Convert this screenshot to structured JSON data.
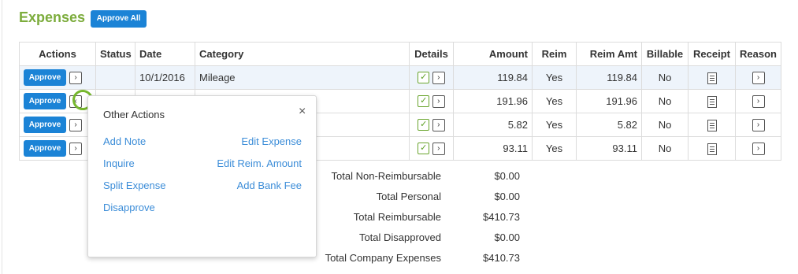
{
  "header": {
    "title": "Expenses",
    "approve_all_label": "Approve All"
  },
  "table": {
    "columns": [
      "Actions",
      "Status",
      "Date",
      "Category",
      "Details",
      "Amount",
      "Reim",
      "Reim Amt",
      "Billable",
      "Receipt",
      "Reason"
    ],
    "approve_label": "Approve",
    "rows": [
      {
        "status": "",
        "date": "10/1/2016",
        "category": "Mileage",
        "amount": "119.84",
        "reim": "Yes",
        "reim_amt": "119.84",
        "billable": "No"
      },
      {
        "status": "",
        "date": "",
        "category": "",
        "amount": "191.96",
        "reim": "Yes",
        "reim_amt": "191.96",
        "billable": "No"
      },
      {
        "status": "",
        "date": "",
        "category": "",
        "amount": "5.82",
        "reim": "Yes",
        "reim_amt": "5.82",
        "billable": "No"
      },
      {
        "status": "",
        "date": "",
        "category": "",
        "amount": "93.11",
        "reim": "Yes",
        "reim_amt": "93.11",
        "billable": "No"
      }
    ]
  },
  "popup": {
    "title": "Other Actions",
    "close": "×",
    "left_actions": [
      "Add Note",
      "Inquire",
      "Split Expense",
      "Disapprove"
    ],
    "right_actions": [
      "Edit Expense",
      "Edit Reim. Amount",
      "Add Bank Fee"
    ]
  },
  "totals": [
    {
      "label": "Total Non-Reimbursable",
      "value": "$0.00"
    },
    {
      "label": "Total Personal",
      "value": "$0.00"
    },
    {
      "label": "Total Reimbursable",
      "value": "$410.73"
    },
    {
      "label": "Total Disapproved",
      "value": "$0.00"
    },
    {
      "label": "Total Company Expenses",
      "value": "$410.73"
    }
  ],
  "icons": {
    "arrow_right": "›",
    "arrow_left": "‹",
    "check": "✓"
  },
  "colors": {
    "accent": "#1b83d6",
    "title_green": "#7cac3c",
    "link": "#3c8dd8",
    "highlight_ring": "#76b72d",
    "selected_row": "#eef4fb"
  }
}
